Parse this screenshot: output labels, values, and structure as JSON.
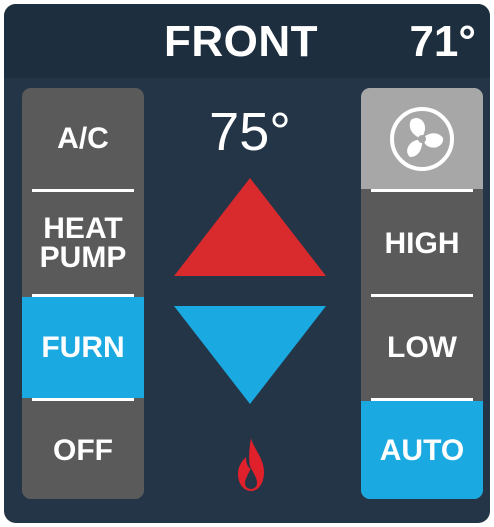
{
  "header": {
    "zone": "FRONT",
    "current_temp": "71°"
  },
  "setpoint": "75°",
  "mode_buttons": [
    {
      "label": "A/C",
      "active": false
    },
    {
      "label": "HEAT\nPUMP",
      "active": false
    },
    {
      "label": "FURN",
      "active": true
    },
    {
      "label": "OFF",
      "active": false
    }
  ],
  "fan": {
    "icon": "fan-icon",
    "buttons": [
      {
        "label": "HIGH",
        "active": false
      },
      {
        "label": "LOW",
        "active": false
      },
      {
        "label": "AUTO",
        "active": true
      }
    ]
  },
  "status_icon": "flame-icon",
  "colors": {
    "background": "#233546",
    "header": "#1d2e3e",
    "button": "#5a5a5a",
    "active": "#1ba9e1",
    "up_arrow": "#d92a2e",
    "down_arrow": "#1ba9e1",
    "flame": "#e0202a"
  }
}
